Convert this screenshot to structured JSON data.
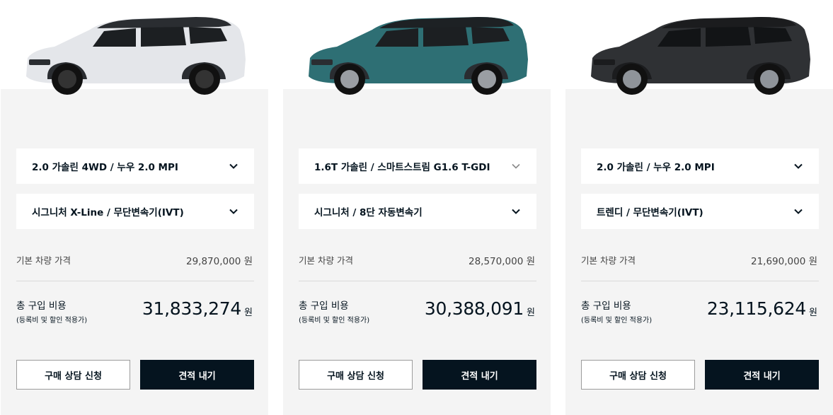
{
  "cars": [
    {
      "engine_option": "2.0 가솔린 4WD / 누우 2.0 MPI",
      "trim_option": "시그니처 X-Line / 무단변속기(IVT)",
      "base_price_label": "기본 차량 가격",
      "base_price": "29,870,000",
      "base_price_unit": "원",
      "total_label": "총 구입 비용",
      "total_sub_label": "(등록비 및 할인 적용가)",
      "total_price": "31,833,274",
      "total_unit": "원",
      "consult_button": "구매 상담 신청",
      "estimate_button": "견적 내기",
      "body_color": "#e4e6ea",
      "roof_color": "#2a2d31"
    },
    {
      "engine_option": "1.6T 가솔린 / 스마트스트림 G1.6 T-GDI",
      "trim_option": "시그니처 / 8단 자동변속기",
      "base_price_label": "기본 차량 가격",
      "base_price": "28,570,000",
      "base_price_unit": "원",
      "total_label": "총 구입 비용",
      "total_sub_label": "(등록비 및 할인 적용가)",
      "total_price": "30,388,091",
      "total_unit": "원",
      "consult_button": "구매 상담 신청",
      "estimate_button": "견적 내기",
      "body_color": "#2e6f74",
      "roof_color": "#1d2124"
    },
    {
      "engine_option": "2.0 가솔린 / 누우 2.0 MPI",
      "trim_option": "트렌디 / 무단변속기(IVT)",
      "base_price_label": "기본 차량 가격",
      "base_price": "21,690,000",
      "base_price_unit": "원",
      "total_label": "총 구입 비용",
      "total_sub_label": "(등록비 및 할인 적용가)",
      "total_price": "23,115,624",
      "total_unit": "원",
      "consult_button": "구매 상담 신청",
      "estimate_button": "견적 내기",
      "body_color": "#2f3134",
      "roof_color": "#1b1c1e"
    }
  ],
  "icons": {
    "dropdown": "chevron-down-icon"
  },
  "colors": {
    "card_bg": "#f4f4f4",
    "primary": "#05141f",
    "chevron_muted": "#8a8a8a"
  }
}
